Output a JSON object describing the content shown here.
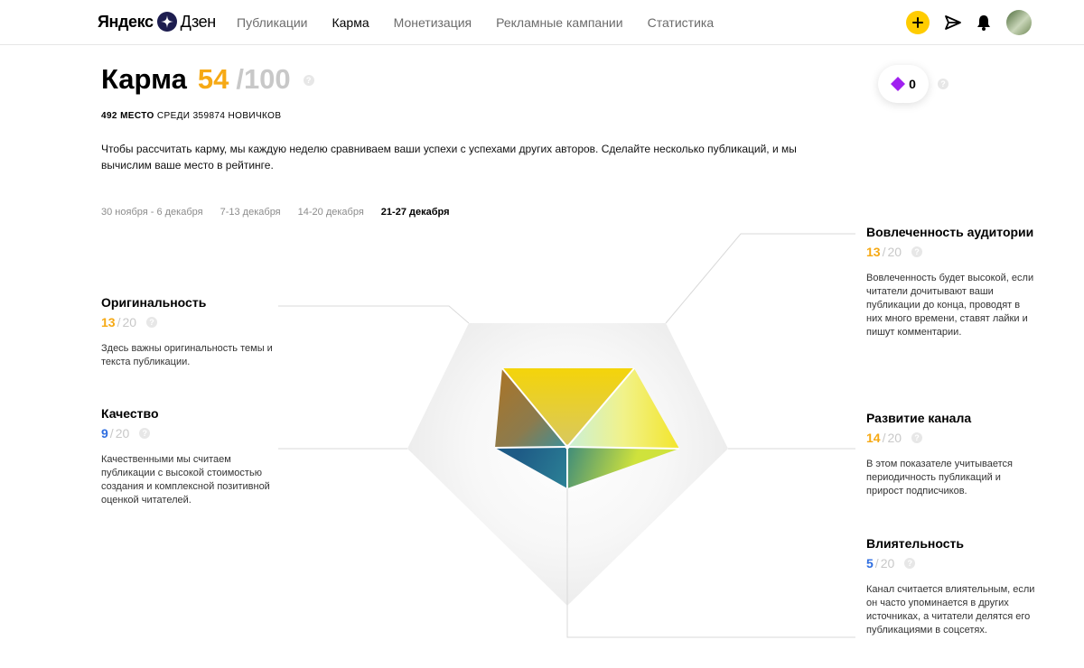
{
  "header": {
    "logo_yandex": "Яндекс",
    "logo_zen": "Дзен",
    "nav": [
      {
        "label": "Публикации"
      },
      {
        "label": "Карма"
      },
      {
        "label": "Монетизация"
      },
      {
        "label": "Рекламные кампании"
      },
      {
        "label": "Статистика"
      }
    ],
    "active_nav": "Карма",
    "icons": [
      "plus-icon",
      "send-icon",
      "bell-icon",
      "avatar"
    ]
  },
  "karma": {
    "title": "Карма",
    "score": "54",
    "max": "/100",
    "rank_place": "492 МЕСТО",
    "rank_rest": "СРЕДИ 359874 НОВИЧКОВ",
    "intro": "Чтобы рассчитать карму, мы каждую неделю сравниваем ваши успехи с успехами других авторов. Сделайте несколько публикаций, и мы вычислим ваше место в рейтинге.",
    "badge_value": "0",
    "help": "?"
  },
  "weeks": [
    {
      "label": "30 ноября - 6 декабря"
    },
    {
      "label": "7-13 декабря"
    },
    {
      "label": "14-20 декабря"
    },
    {
      "label": "21-27 декабря"
    }
  ],
  "active_week": "21-27 декабря",
  "metrics": {
    "originality": {
      "name": "Оригинальность",
      "value": "13",
      "max": "20",
      "desc": "Здесь важны оригинальность темы и текста публикации."
    },
    "quality": {
      "name": "Качество",
      "value": "9",
      "max": "20",
      "desc": "Качественными мы считаем публикации с высокой стоимостью создания и комплексной позитивной оценкой читателей."
    },
    "engagement": {
      "name": "Вовлеченность аудитории",
      "value": "13",
      "max": "20",
      "desc": "Вовлеченность будет высокой, если читатели дочитывают ваши публикации до конца, проводят в них много времени, ставят лайки и пишут комментарии."
    },
    "growth": {
      "name": "Развитие канала",
      "value": "14",
      "max": "20",
      "desc": "В этом показателе учитывается периодичность публикаций и прирост подписчиков."
    },
    "influence": {
      "name": "Влиятельность",
      "value": "5",
      "max": "20",
      "desc": "Канал считается влиятельным, если он часто упоминается в других источниках, а читатели делятся его публикациями в соцсетях."
    }
  },
  "colors": {
    "accent": "#f6a914",
    "blue_value": "#2f6ee0",
    "badge_diamond": "#a020f0",
    "yellow_button": "#ffcc00"
  }
}
